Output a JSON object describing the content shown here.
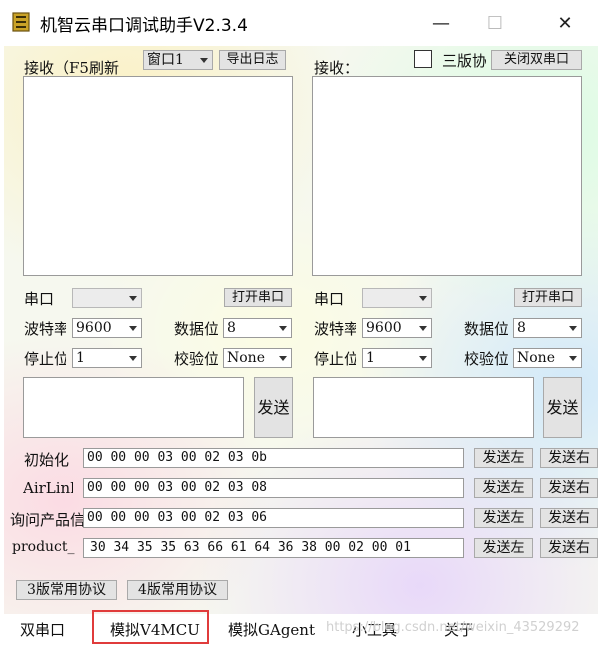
{
  "window": {
    "title": "机智云串口调试助手V2.3.4",
    "minimize": "—",
    "maximize": "☐",
    "close": "✕"
  },
  "left": {
    "receive_label": "接收（F5刷新",
    "window_select": "窗口1",
    "export_log": "导出日志",
    "port_label": "串口",
    "port_value": "",
    "open_port": "打开串口",
    "baud_label": "波特率",
    "baud_value": "9600",
    "databits_label": "数据位",
    "databits_value": "8",
    "stopbits_label": "停止位",
    "stopbits_value": "1",
    "parity_label": "校验位",
    "parity_value": "None",
    "send": "发送"
  },
  "right": {
    "receive_label": "接收：",
    "v3_label": "三版协",
    "close_dual": "关闭双串口",
    "port_label": "串口",
    "port_value": "",
    "open_port": "打开串口",
    "baud_label": "波特率",
    "baud_value": "9600",
    "databits_label": "数据位",
    "databits_value": "8",
    "stopbits_label": "停止位",
    "stopbits_value": "1",
    "parity_label": "校验位",
    "parity_value": "None",
    "send": "发送"
  },
  "commands": [
    {
      "label": "初始化",
      "hex": "00 00 00 03 00 02 03 0b",
      "send_left": "发送左",
      "send_right": "发送右"
    },
    {
      "label": "AirLink",
      "hex": "00 00 00 03 00 02 03 08",
      "send_left": "发送左",
      "send_right": "发送右"
    },
    {
      "label": "询问产品信",
      "hex": "00 00 00 03 00 02 03 06",
      "send_left": "发送左",
      "send_right": "发送右"
    },
    {
      "label": "product_",
      "hex": "30 34 35 35 63 66 61 64 36 38 00 02 00 01",
      "send_left": "发送左",
      "send_right": "发送右"
    }
  ],
  "protocol_buttons": {
    "v3": "3版常用协议",
    "v4": "4版常用协议"
  },
  "tabs": [
    "双串口",
    "模拟V4MCU",
    "模拟GAgent",
    "小工具",
    "关于"
  ],
  "watermark": "https://blog.csdn.net/weixin_43529292"
}
